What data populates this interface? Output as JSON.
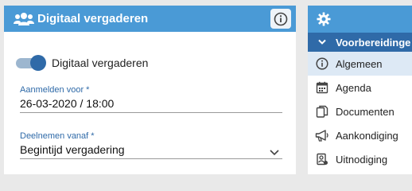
{
  "card": {
    "title": "Digitaal vergaderen",
    "header_icon": "users-icon",
    "info_icon": "info-icon"
  },
  "toggle": {
    "label": "Digitaal vergaderen",
    "checked": true
  },
  "aanmelden": {
    "label": "Aanmelden voor *",
    "value": "26-03-2020 / 18:00"
  },
  "deelnemen": {
    "label": "Deelnemen vanaf *",
    "value": "Begintijd vergadering",
    "icon": "chevron-down-icon"
  },
  "sidebar": {
    "header_icon": "gear-icon",
    "section": {
      "label": "Voorbereidinge",
      "icon": "chevron-down-icon"
    },
    "items": [
      {
        "label": "Algemeen",
        "icon": "info-icon",
        "active": true
      },
      {
        "label": "Agenda",
        "icon": "calendar-icon",
        "active": false
      },
      {
        "label": "Documenten",
        "icon": "documents-icon",
        "active": false
      },
      {
        "label": "Aankondiging",
        "icon": "megaphone-icon",
        "active": false
      },
      {
        "label": "Uitnodiging",
        "icon": "invitation-icon",
        "active": false
      }
    ]
  },
  "colors": {
    "header_blue": "#4a9ad6",
    "section_blue": "#2f6aa8",
    "active_item": "#dde9f5",
    "toggle_knob": "#2f6aa8",
    "background": "#e9e9e9"
  }
}
